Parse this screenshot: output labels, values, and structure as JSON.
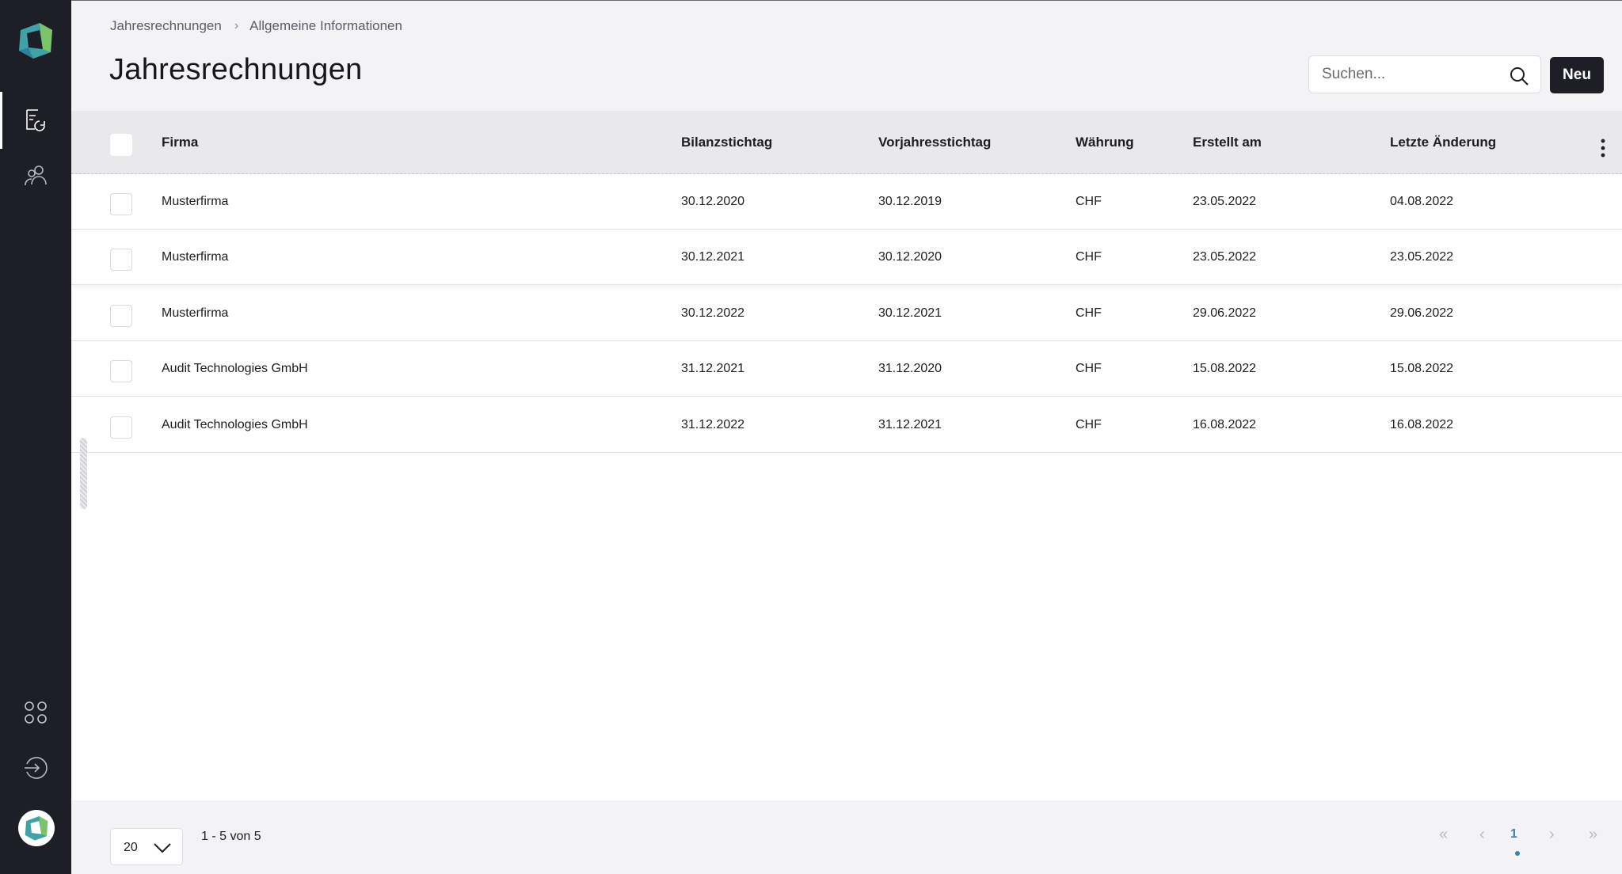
{
  "breadcrumb": {
    "items": [
      "Jahresrechnungen",
      "Allgemeine Informationen"
    ],
    "separator": "›"
  },
  "page": {
    "title": "Jahresrechnungen"
  },
  "search": {
    "placeholder": "Suchen...",
    "value": ""
  },
  "toolbar": {
    "new_label": "Neu"
  },
  "table": {
    "columns": [
      "Firma",
      "Bilanzstichtag",
      "Vorjahresstichtag",
      "Währung",
      "Erstellt am",
      "Letzte Änderung"
    ],
    "rows": [
      [
        "Musterfirma",
        "30.12.2020",
        "30.12.2019",
        "CHF",
        "23.05.2022",
        "04.08.2022"
      ],
      [
        "Musterfirma",
        "30.12.2021",
        "30.12.2020",
        "CHF",
        "23.05.2022",
        "23.05.2022"
      ],
      [
        "Musterfirma",
        "30.12.2022",
        "30.12.2021",
        "CHF",
        "29.06.2022",
        "29.06.2022"
      ],
      [
        "Audit Technologies GmbH",
        "31.12.2021",
        "31.12.2020",
        "CHF",
        "15.08.2022",
        "15.08.2022"
      ],
      [
        "Audit Technologies GmbH",
        "31.12.2022",
        "31.12.2021",
        "CHF",
        "16.08.2022",
        "16.08.2022"
      ]
    ]
  },
  "footer": {
    "page_size": "20",
    "range_text": "1 - 5 von 5",
    "pagination": {
      "first": "«",
      "prev": "‹",
      "current": "1",
      "next": "›",
      "last": "»"
    }
  },
  "sidebar": {
    "icons": [
      "app-logo-icon",
      "annual-accounts-icon",
      "users-icon",
      "apps-grid-icon",
      "logout-icon",
      "avatar-logo-icon"
    ]
  },
  "colors": {
    "sidebar_bg": "#1e1e27",
    "header_bg": "#f3f3f5",
    "table_header_bg": "#e9e9ec",
    "primary_button": "#1e1e27",
    "accent": "#3f7fb0",
    "logo_teal": "#3fa3a6",
    "logo_green": "#7cc36a"
  }
}
